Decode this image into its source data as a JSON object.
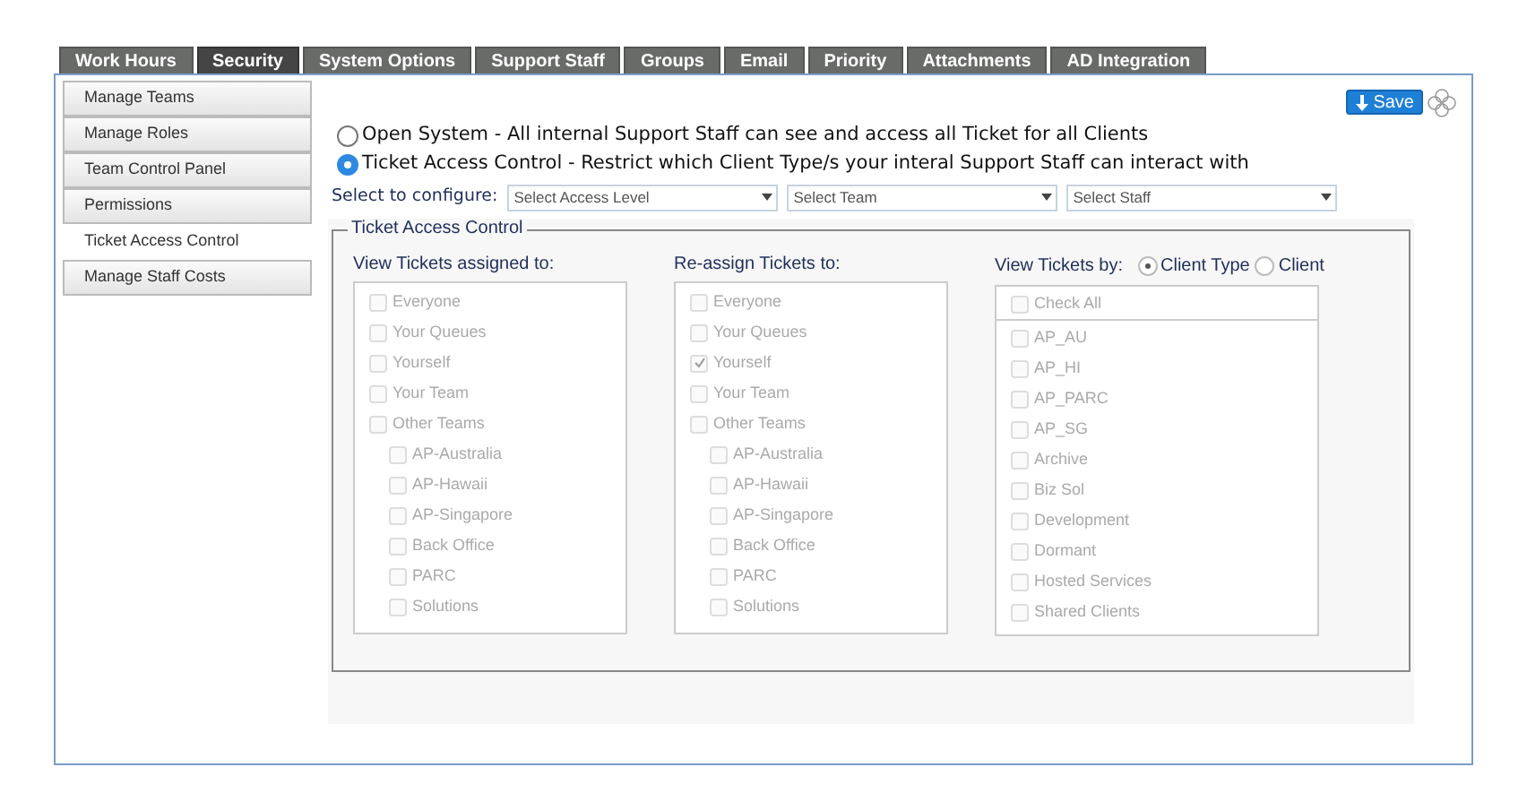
{
  "tabs": [
    {
      "label": "Work Hours",
      "selected": false
    },
    {
      "label": "Security",
      "selected": true
    },
    {
      "label": "System Options",
      "selected": false
    },
    {
      "label": "Support Staff",
      "selected": false
    },
    {
      "label": "Groups",
      "selected": false
    },
    {
      "label": "Email",
      "selected": false
    },
    {
      "label": "Priority",
      "selected": false
    },
    {
      "label": "Attachments",
      "selected": false
    },
    {
      "label": "AD Integration",
      "selected": false
    }
  ],
  "sidebar": {
    "items": [
      {
        "label": "Manage Teams",
        "selected": false
      },
      {
        "label": "Manage Roles",
        "selected": false
      },
      {
        "label": "Team Control Panel",
        "selected": false
      },
      {
        "label": "Permissions",
        "selected": false
      },
      {
        "label": "Ticket Access Control",
        "selected": true
      },
      {
        "label": "Manage Staff Costs",
        "selected": false
      }
    ]
  },
  "save_button": "Save",
  "mode_options": [
    {
      "label": "Open System - All internal Support Staff can see and access all Ticket for all Clients",
      "selected": false
    },
    {
      "label": "Ticket Access Control - Restrict which Client Type/s your interal Support Staff can interact with",
      "selected": true
    }
  ],
  "configure": {
    "label": "Select to configure:",
    "selects": [
      {
        "placeholder": "Select Access Level"
      },
      {
        "placeholder": "Select Team"
      },
      {
        "placeholder": "Select Staff"
      }
    ]
  },
  "fieldset": {
    "legend": "Ticket Access Control",
    "view_assigned": {
      "title": "View Tickets assigned to:",
      "disabled": true,
      "items": [
        {
          "label": "Everyone",
          "checked": false
        },
        {
          "label": "Your Queues",
          "checked": false
        },
        {
          "label": "Yourself",
          "checked": false
        },
        {
          "label": "Your Team",
          "checked": false
        },
        {
          "label": "Other Teams",
          "checked": false,
          "children": [
            {
              "label": "AP-Australia",
              "checked": false
            },
            {
              "label": "AP-Hawaii",
              "checked": false
            },
            {
              "label": "AP-Singapore",
              "checked": false
            },
            {
              "label": "Back Office",
              "checked": false
            },
            {
              "label": "PARC",
              "checked": false
            },
            {
              "label": "Solutions",
              "checked": false
            }
          ]
        }
      ]
    },
    "reassign": {
      "title": "Re-assign Tickets to:",
      "disabled": true,
      "items": [
        {
          "label": "Everyone",
          "checked": false
        },
        {
          "label": "Your Queues",
          "checked": false
        },
        {
          "label": "Yourself",
          "checked": true
        },
        {
          "label": "Your Team",
          "checked": false
        },
        {
          "label": "Other Teams",
          "checked": false,
          "children": [
            {
              "label": "AP-Australia",
              "checked": false
            },
            {
              "label": "AP-Hawaii",
              "checked": false
            },
            {
              "label": "AP-Singapore",
              "checked": false
            },
            {
              "label": "Back Office",
              "checked": false
            },
            {
              "label": "PARC",
              "checked": false
            },
            {
              "label": "Solutions",
              "checked": false
            }
          ]
        }
      ]
    },
    "view_by": {
      "title": "View Tickets by:",
      "options": [
        {
          "label": "Client Type",
          "selected": true
        },
        {
          "label": "Client",
          "selected": false
        }
      ],
      "disabled": true,
      "check_all": {
        "label": "Check All",
        "checked": false
      },
      "items": [
        {
          "label": "AP_AU",
          "checked": false
        },
        {
          "label": "AP_HI",
          "checked": false
        },
        {
          "label": "AP_PARC",
          "checked": false
        },
        {
          "label": "AP_SG",
          "checked": false
        },
        {
          "label": "Archive",
          "checked": false
        },
        {
          "label": "Biz Sol",
          "checked": false
        },
        {
          "label": "Development",
          "checked": false
        },
        {
          "label": "Dormant",
          "checked": false
        },
        {
          "label": "Hosted Services",
          "checked": false
        },
        {
          "label": "Shared Clients",
          "checked": false
        }
      ]
    }
  }
}
